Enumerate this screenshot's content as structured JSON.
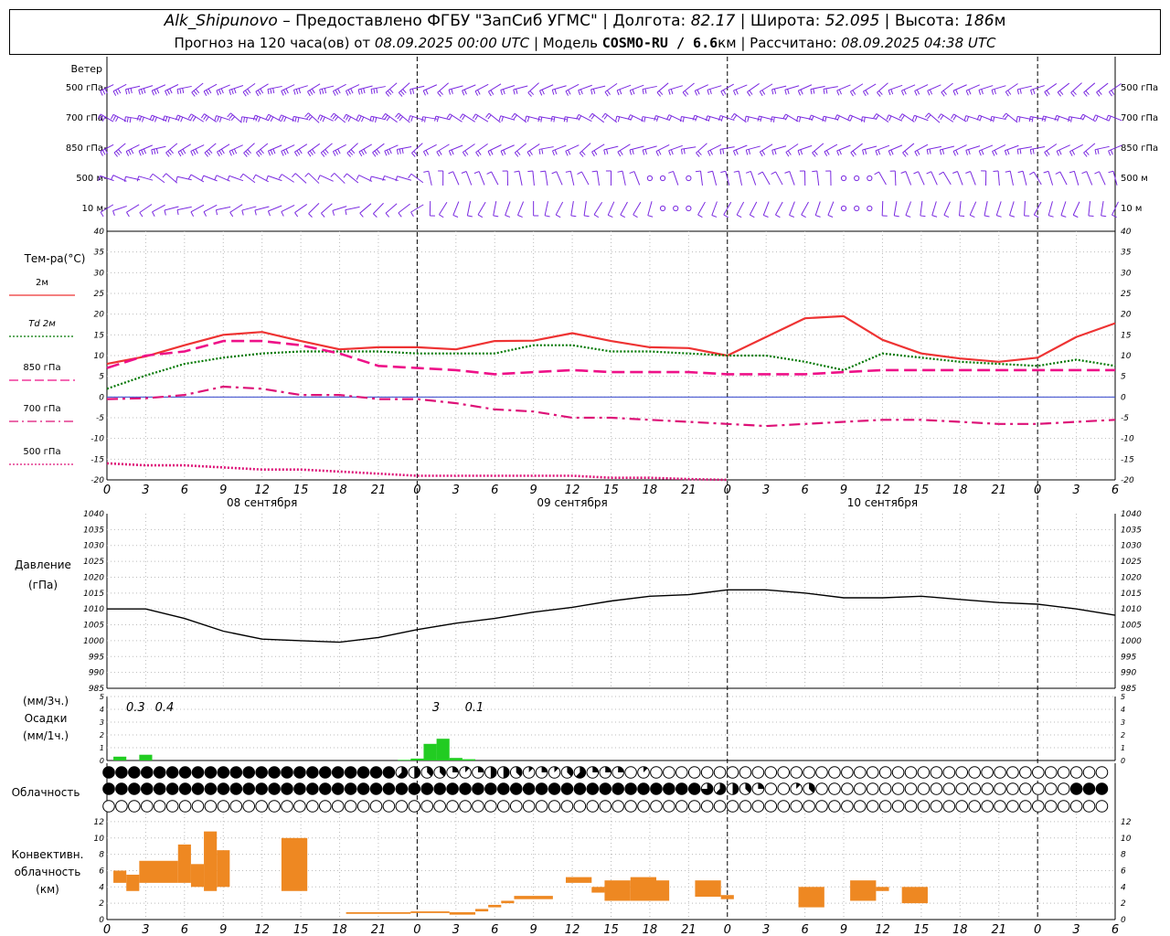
{
  "header": {
    "station": "Alk_Shipunovo",
    "provider": "– Предоставлено ФГБУ \"ЗапСиб УГМС\"",
    "lon_label": "Долгота:",
    "lon": "82.17",
    "lat_label": "Широта:",
    "lat": "52.095",
    "alt_label": "Высота:",
    "alt": "186",
    "alt_unit": "м",
    "forecast_label": "Прогноз на 120 часа(ов) от",
    "forecast_from": "08.09.2025 00:00 UTC",
    "model_label": "Модель",
    "model": "COSMO-RU / 6.6",
    "model_unit": "км",
    "calc_label": "Рассчитано:",
    "calc_time": "08.09.2025 04:38 UTC"
  },
  "labels": {
    "wind": "Ветер",
    "wind_levels": [
      "500 гПа",
      "700 гПа",
      "850 гПа",
      "500 м",
      "10 м"
    ],
    "temp_title": "Тем-ра(°C)",
    "pressure_title": "Давление",
    "pressure_unit": "(гПа)",
    "precip_unit_3h": "(мм/3ч.)",
    "precip_title": "Осадки",
    "precip_unit_1h": "(мм/1ч.)",
    "cloud_title": "Облачность",
    "conv_title": "Конвективн.",
    "conv_title2": "облачность",
    "conv_unit": "(км)",
    "days": [
      "08 сентября",
      "09 сентября",
      "10 сентября"
    ],
    "hours": [
      "0",
      "3",
      "6",
      "9",
      "12",
      "15",
      "18",
      "21",
      "0",
      "3",
      "6",
      "9",
      "12",
      "15",
      "18",
      "21",
      "0",
      "3",
      "6",
      "9",
      "12",
      "15",
      "18",
      "21",
      "0",
      "3",
      "6"
    ]
  },
  "colors": {
    "t2m": "#ee3333",
    "td2m": "#007700",
    "t850": "#ee1188",
    "t700": "#dd1177",
    "t500": "#dd1177",
    "wind": "#7a2ae0",
    "precip": "#22cc22",
    "conv": "#ee8822"
  },
  "chart_data": [
    {
      "type": "line",
      "title": "Тем-ра(°C)",
      "x_hours": [
        0,
        3,
        6,
        9,
        12,
        15,
        18,
        21,
        24,
        27,
        30,
        33,
        36,
        39,
        42,
        45,
        48,
        51,
        54,
        57,
        60,
        63,
        66,
        69,
        72,
        75,
        78
      ],
      "ylim": [
        -20,
        40
      ],
      "grid": true,
      "series": [
        {
          "name": "2м",
          "key": "t2m",
          "style": "solid",
          "values": [
            8,
            9.8,
            12.5,
            15,
            15.7,
            13.5,
            11.5,
            12,
            12,
            11.5,
            13.5,
            13.6,
            15.4,
            13.5,
            12,
            11.8,
            10,
            14.5,
            19,
            19.5,
            13.8,
            10.5,
            9.3,
            8.5,
            9.5,
            14.5,
            17.8
          ]
        },
        {
          "name": "Td 2м",
          "key": "td2m",
          "style": "dotted",
          "values": [
            2,
            5.2,
            8,
            9.5,
            10.5,
            11,
            11,
            11,
            10.5,
            10.5,
            10.5,
            12.5,
            12.5,
            11,
            11,
            10.5,
            10,
            10,
            8.5,
            6.5,
            10.5,
            9.5,
            8.5,
            8,
            7.5,
            9,
            7.5
          ]
        },
        {
          "name": "850 гПа",
          "key": "t850",
          "style": "dashed",
          "values": [
            7,
            10,
            11,
            13.5,
            13.5,
            12.5,
            10.5,
            7.5,
            7,
            6.5,
            5.5,
            6,
            6.5,
            6,
            6,
            6,
            5.5,
            5.5,
            5.5,
            6,
            6.5,
            6.5,
            6.5,
            6.5,
            6.5,
            6.5,
            6.5
          ]
        },
        {
          "name": "700 гПа",
          "key": "t700",
          "style": "dashdot",
          "values": [
            -0.5,
            -0.3,
            0.5,
            2.5,
            2,
            0.5,
            0.5,
            -0.5,
            -0.5,
            -1.5,
            -3,
            -3.5,
            -5,
            -5,
            -5.5,
            -6,
            -6.5,
            -7,
            -6.5,
            -6,
            -5.5,
            -5.5,
            -6,
            -6.5,
            -6.5,
            -6,
            -5.5
          ]
        },
        {
          "name": "500 гПа",
          "key": "t500",
          "style": "dotted",
          "values": [
            -16,
            -16.5,
            -16.5,
            -17,
            -17.5,
            -17.5,
            -18,
            -18.5,
            -19,
            -19,
            -19,
            -19,
            -19,
            -19.5,
            -19.5,
            -19.8,
            -20,
            null,
            null,
            null,
            null,
            null,
            null,
            null,
            null,
            null,
            null
          ]
        }
      ]
    },
    {
      "type": "line",
      "title": "Давление",
      "ylabel": "(гПа)",
      "x_hours": [
        0,
        3,
        6,
        9,
        12,
        15,
        18,
        21,
        24,
        27,
        30,
        33,
        36,
        39,
        42,
        45,
        48,
        51,
        54,
        57,
        60,
        63,
        66,
        69,
        72,
        75,
        78
      ],
      "ylim": [
        985,
        1040
      ],
      "grid": true,
      "series": [
        {
          "name": "Давление",
          "values": [
            1010,
            1010,
            1007,
            1003,
            1000.5,
            1000,
            999.5,
            1001,
            1003.5,
            1005.5,
            1007,
            1009,
            1010.5,
            1012.5,
            1014,
            1014.5,
            1016,
            1016,
            1015,
            1013.5,
            1013.5,
            1014,
            1013,
            1012,
            1011.5,
            1010,
            1008
          ]
        }
      ]
    },
    {
      "type": "bar",
      "title": "Осадки",
      "ylabel": "(мм/1ч.)",
      "ylim": [
        0,
        5
      ],
      "hourly_x": [
        1,
        3,
        23,
        24,
        25,
        26,
        27,
        28
      ],
      "hourly_values": [
        0.3,
        0.45,
        0.05,
        0.15,
        1.3,
        1.7,
        0.2,
        0.1
      ],
      "labels_3h": [
        {
          "x": 1.5,
          "text": "0.3"
        },
        {
          "x": 4.5,
          "text": "0.4"
        },
        {
          "x": 25.5,
          "text": "3"
        },
        {
          "x": 28.5,
          "text": "0.1"
        }
      ]
    },
    {
      "type": "bar",
      "title": "Конвективн. облачность",
      "ylabel": "(км)",
      "ylim": [
        0,
        13
      ],
      "segments": [
        {
          "x0": 0.5,
          "x1": 1.5,
          "y0": 4.5,
          "y1": 6
        },
        {
          "x0": 1.5,
          "x1": 2.5,
          "y0": 3.5,
          "y1": 5.5
        },
        {
          "x0": 2.5,
          "x1": 5.5,
          "y0": 4.5,
          "y1": 7.2
        },
        {
          "x0": 5.5,
          "x1": 6.5,
          "y0": 4.5,
          "y1": 9.2
        },
        {
          "x0": 6.5,
          "x1": 7.5,
          "y0": 4,
          "y1": 6.8
        },
        {
          "x0": 7.5,
          "x1": 8.5,
          "y0": 3.5,
          "y1": 10.8
        },
        {
          "x0": 8.5,
          "x1": 9.5,
          "y0": 4,
          "y1": 8.5
        },
        {
          "x0": 13.5,
          "x1": 15.5,
          "y0": 3.5,
          "y1": 10
        },
        {
          "x0": 18.5,
          "x1": 23.5,
          "y0": 0.7,
          "y1": 0.9
        },
        {
          "x0": 23.5,
          "x1": 26.5,
          "y0": 0.8,
          "y1": 1
        },
        {
          "x0": 26.5,
          "x1": 28.5,
          "y0": 0.6,
          "y1": 0.9
        },
        {
          "x0": 28.5,
          "x1": 29.5,
          "y0": 1,
          "y1": 1.3
        },
        {
          "x0": 29.5,
          "x1": 30.5,
          "y0": 1.5,
          "y1": 1.8
        },
        {
          "x0": 30.5,
          "x1": 31.5,
          "y0": 2,
          "y1": 2.3
        },
        {
          "x0": 31.5,
          "x1": 34.5,
          "y0": 2.5,
          "y1": 2.9
        },
        {
          "x0": 35.5,
          "x1": 37.5,
          "y0": 4.5,
          "y1": 5.2
        },
        {
          "x0": 37.5,
          "x1": 38.5,
          "y0": 3.3,
          "y1": 4
        },
        {
          "x0": 38.5,
          "x1": 40.5,
          "y0": 2.3,
          "y1": 4.8
        },
        {
          "x0": 40.5,
          "x1": 42.5,
          "y0": 2.3,
          "y1": 5.2
        },
        {
          "x0": 42.5,
          "x1": 43.5,
          "y0": 2.3,
          "y1": 4.8
        },
        {
          "x0": 45.5,
          "x1": 47.5,
          "y0": 2.8,
          "y1": 4.8
        },
        {
          "x0": 47.5,
          "x1": 48.5,
          "y0": 2.5,
          "y1": 3
        },
        {
          "x0": 53.5,
          "x1": 55.5,
          "y0": 1.5,
          "y1": 4
        },
        {
          "x0": 57.5,
          "x1": 59.5,
          "y0": 2.3,
          "y1": 4.8
        },
        {
          "x0": 59.5,
          "x1": 60.5,
          "y0": 3.5,
          "y1": 4
        },
        {
          "x0": 61.5,
          "x1": 63.5,
          "y0": 2,
          "y1": 4
        }
      ]
    },
    {
      "type": "table",
      "title": "Облачность",
      "cover_hourly_0_to_8": {
        "high": "8888888888888888888888854332124431213522201000000000000000000000000000000000000002000000000000000000000000000000888888888888888888888845443322322432",
        "mid": "8888888888888888888888888888888888888888888888865432001300000000000000000000888888888888888888888888888888888888888888888888888888888888888888",
        "low": "0000000000000000000000000000000000000000000000000000000000000000000000000000000000000000000000000000000000000000000000000000000000000000000000000000"
      }
    }
  ]
}
